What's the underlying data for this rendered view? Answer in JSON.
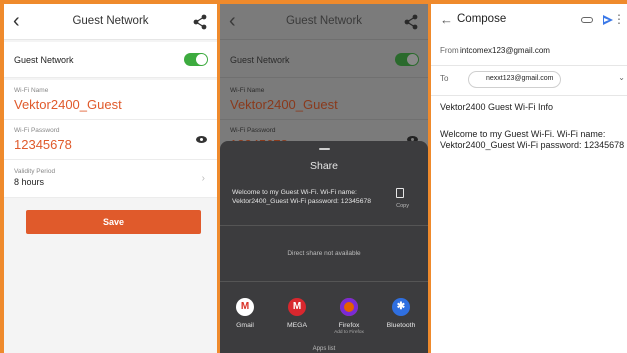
{
  "panel1": {
    "title": "Guest Network",
    "guest_network_label": "Guest Network",
    "guest_network_on": true,
    "wifi_name_label": "Wi-Fi Name",
    "wifi_name": "Vektor2400_Guest",
    "wifi_password_label": "Wi-Fi Password",
    "wifi_password": "12345678",
    "validity_label": "Validity Period",
    "validity_value": "8 hours",
    "save_label": "Save"
  },
  "panel2": {
    "sheet_title": "Share",
    "share_text": "Welcome to my Guest Wi-Fi. Wi-Fi name: Vektor2400_Guest Wi-Fi password: 12345678",
    "copy_label": "Copy",
    "direct_share": "Direct share not available",
    "apps": [
      {
        "name": "Gmail",
        "sub": "",
        "icon": "gmail-icon",
        "color": "#ffffff"
      },
      {
        "name": "MEGA",
        "sub": "",
        "icon": "mega-icon",
        "color": "#d9272e"
      },
      {
        "name": "Firefox",
        "sub": "Add to Firefox",
        "icon": "firefox-icon",
        "color": "#e66000"
      },
      {
        "name": "Bluetooth",
        "sub": "",
        "icon": "bluetooth-icon",
        "color": "#2f6fe0"
      }
    ],
    "apps_list": "Apps list"
  },
  "panel3": {
    "title": "Compose",
    "from_label": "From",
    "from_value": "intcomex123@gmail.com",
    "to_label": "To",
    "to_value": "nexxt123@gmail.com",
    "subject": "Vektor2400 Guest Wi-Fi Info",
    "body": "Welcome to my Guest Wi-Fi. Wi-Fi name: Vektor2400_Guest Wi-Fi password: 12345678"
  },
  "colors": {
    "accent": "#e05a2b",
    "toggle_on": "#3dab3f",
    "frame": "#ef8a2c",
    "send": "#3a78e8"
  }
}
